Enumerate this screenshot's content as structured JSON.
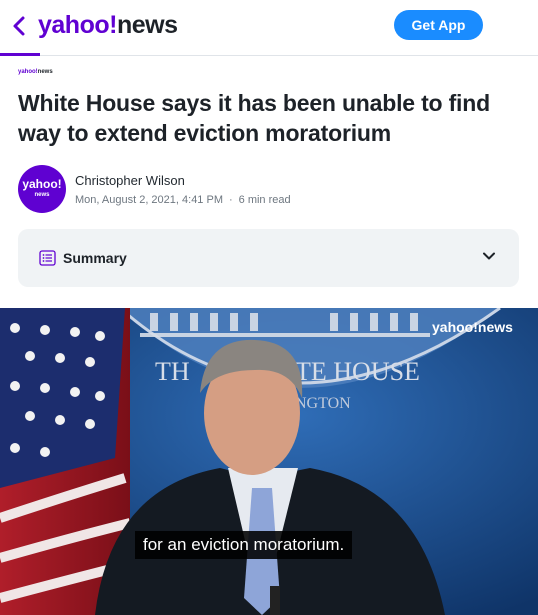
{
  "header": {
    "logo_yahoo": "yahoo",
    "logo_bang": "!",
    "logo_news": "news",
    "get_app_label": "Get App"
  },
  "article": {
    "source_yahoo": "yahoo!",
    "source_news": "news",
    "title": "White House says it has been unable to find way to extend eviction moratorium",
    "author": "Christopher Wilson",
    "date": "Mon, August 2, 2021, 4:41 PM",
    "separator": "·",
    "read_time": "6 min read",
    "avatar_line1": "yahoo!",
    "avatar_line2": "news"
  },
  "summary": {
    "label": "Summary"
  },
  "video": {
    "sign_left": "TH",
    "sign_right": "TE HOUSE",
    "sign_sub": "NGTON",
    "logo_yahoo": "yahoo",
    "logo_bang": "!",
    "logo_news": "news",
    "caption": "for an eviction moratorium."
  },
  "colors": {
    "brand_purple": "#6001d2",
    "button_blue": "#1a8cff",
    "text_dark": "#1d2228",
    "summary_bg": "#f0f3f5"
  },
  "icons": [
    "chevron-left-icon",
    "list-icon",
    "chevron-down-icon"
  ]
}
